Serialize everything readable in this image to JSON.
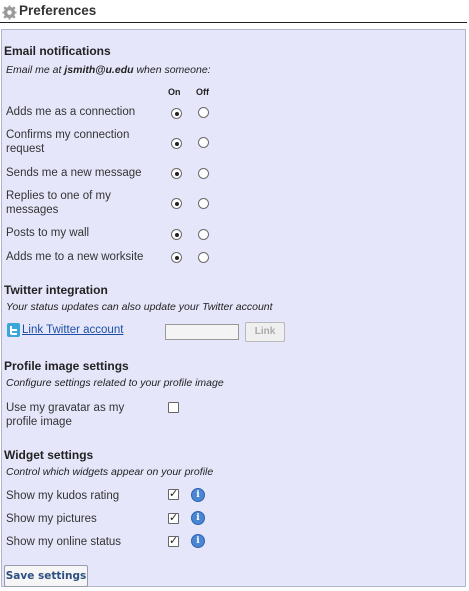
{
  "header": {
    "title": "Preferences",
    "icon": "gear-icon"
  },
  "email": {
    "title": "Email notifications",
    "subtitle_prefix": "Email me at ",
    "email_address": "jsmith@u.edu",
    "subtitle_suffix": " when someone:",
    "col_on": "On",
    "col_off": "Off",
    "items": [
      {
        "label": "Adds me as a connection",
        "value": "on"
      },
      {
        "label": "Confirms my connection request",
        "value": "on"
      },
      {
        "label": "Sends me a new message",
        "value": "on"
      },
      {
        "label": "Replies to one of my messages",
        "value": "on"
      },
      {
        "label": "Posts to my wall",
        "value": "on"
      },
      {
        "label": "Adds me to a new worksite",
        "value": "on"
      }
    ]
  },
  "twitter": {
    "title": "Twitter integration",
    "subtitle": "Your status updates can also update your Twitter account",
    "link_label": "Link Twitter account",
    "input_value": "",
    "button_label": "Link"
  },
  "profile_image": {
    "title": "Profile image settings",
    "subtitle": "Configure settings related to your profile image",
    "gravatar_label": "Use my gravatar as my profile image",
    "gravatar_checked": false
  },
  "widgets": {
    "title": "Widget settings",
    "subtitle": "Control which widgets appear on your profile",
    "items": [
      {
        "label": "Show my kudos rating",
        "checked": true
      },
      {
        "label": "Show my pictures",
        "checked": true
      },
      {
        "label": "Show my online status",
        "checked": true
      }
    ]
  },
  "save_label": "Save settings"
}
